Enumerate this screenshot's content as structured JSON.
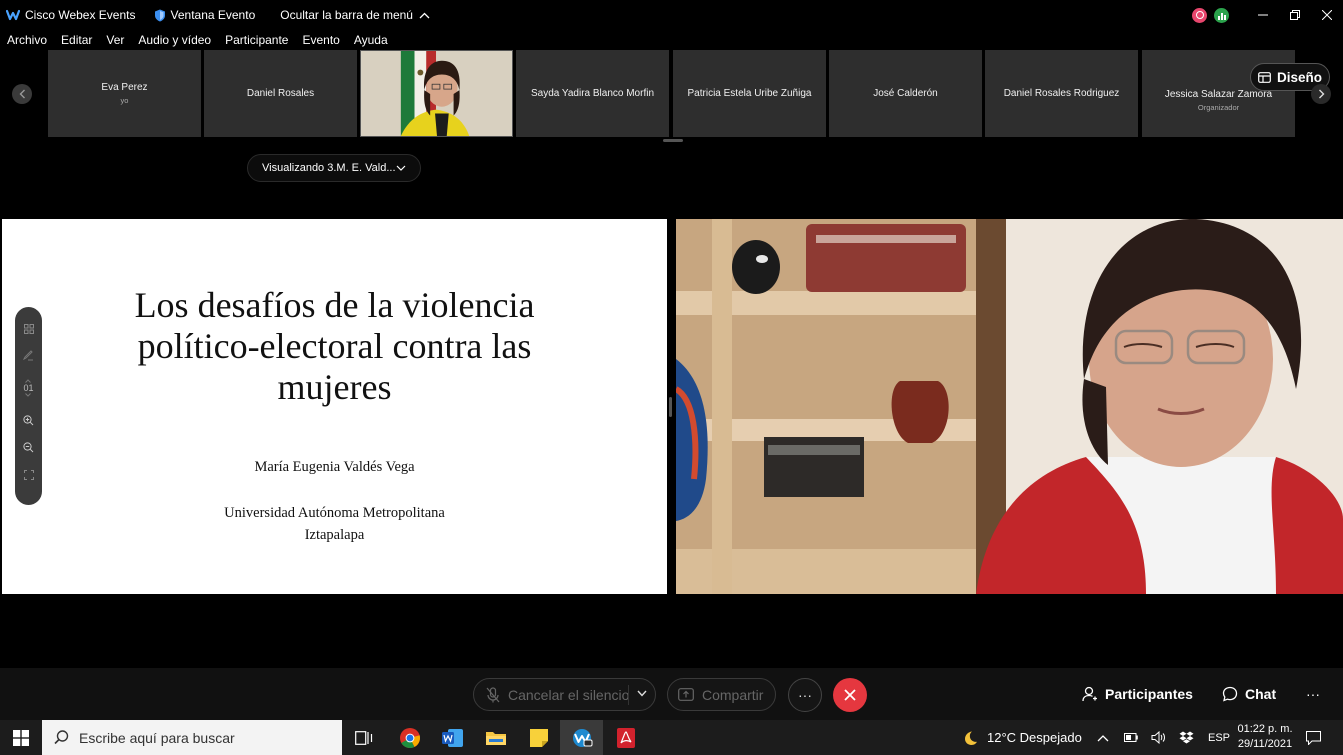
{
  "titlebar": {
    "app_name": "Cisco Webex Events",
    "window_label": "Ventana Evento",
    "hide_menu": "Ocultar la barra de menú"
  },
  "menu": [
    "Archivo",
    "Editar",
    "Ver",
    "Audio y vídeo",
    "Participante",
    "Evento",
    "Ayuda"
  ],
  "participants": [
    {
      "name": "Eva Perez",
      "role": "yo"
    },
    {
      "name": "Daniel Rosales",
      "role": ""
    },
    {
      "name": "",
      "role": "",
      "video": true
    },
    {
      "name": "Sayda Yadira Blanco Morfin",
      "role": ""
    },
    {
      "name": "Patricia Estela Uribe Zuñiga",
      "role": ""
    },
    {
      "name": "José Calderón",
      "role": ""
    },
    {
      "name": "Daniel Rosales Rodriguez",
      "role": ""
    },
    {
      "name": "Jessica Salazar Zamora",
      "role": "Organizador"
    }
  ],
  "layout_button": "Diseño",
  "viewing": "Visualizando 3.M. E. Vald...",
  "slide": {
    "title": "Los desafíos de la violencia político-electoral contra las mujeres",
    "author": "María Eugenia Valdés Vega",
    "institution_line1": "Universidad Autónoma Metropolitana",
    "institution_line2": "Iztapalapa",
    "page": "01"
  },
  "controls": {
    "mute": "Cancelar el silencio",
    "share": "Compartir",
    "more": "···",
    "participants": "Participantes",
    "chat": "Chat",
    "more_right": "···"
  },
  "taskbar": {
    "search_placeholder": "Escribe aquí para buscar",
    "weather": "12°C  Despejado",
    "language": "ESP",
    "time": "01:22 p. m.",
    "date": "29/11/2021"
  },
  "colors": {
    "end_call": "#e5373f",
    "recording": "#e7466d",
    "audio": "#2ba24c"
  }
}
